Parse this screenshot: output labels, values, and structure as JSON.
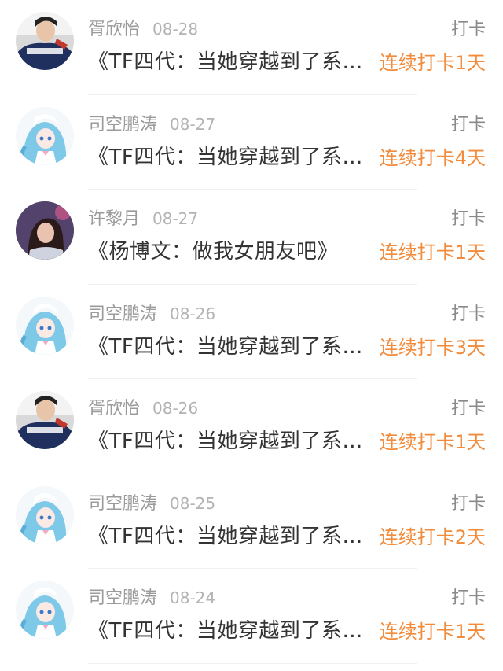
{
  "action_label": "打卡",
  "entries": [
    {
      "user": "胥欣怡",
      "date": "08-28",
      "title": "《TF四代：当她穿越到了系统世界》",
      "streak": "连续打卡1天",
      "avatar": "boy-hoodie"
    },
    {
      "user": "司空鹏涛",
      "date": "08-27",
      "title": "《TF四代：当她穿越到了系统世界》",
      "streak": "连续打卡4天",
      "avatar": "anime-girl"
    },
    {
      "user": "许黎月",
      "date": "08-27",
      "title": "《杨博文：做我女朋友吧》",
      "streak": "连续打卡1天",
      "avatar": "photo-girl"
    },
    {
      "user": "司空鹏涛",
      "date": "08-26",
      "title": "《TF四代：当她穿越到了系统世界》",
      "streak": "连续打卡3天",
      "avatar": "anime-girl"
    },
    {
      "user": "胥欣怡",
      "date": "08-26",
      "title": "《TF四代：当她穿越到了系统世界》",
      "streak": "连续打卡1天",
      "avatar": "boy-hoodie"
    },
    {
      "user": "司空鹏涛",
      "date": "08-25",
      "title": "《TF四代：当她穿越到了系统世界》",
      "streak": "连续打卡2天",
      "avatar": "anime-girl"
    },
    {
      "user": "司空鹏涛",
      "date": "08-24",
      "title": "《TF四代：当她穿越到了系统世界》",
      "streak": "连续打卡1天",
      "avatar": "anime-girl"
    }
  ],
  "colors": {
    "streak": "#f28b3b",
    "name": "#9b9b9b",
    "title": "#333333"
  }
}
